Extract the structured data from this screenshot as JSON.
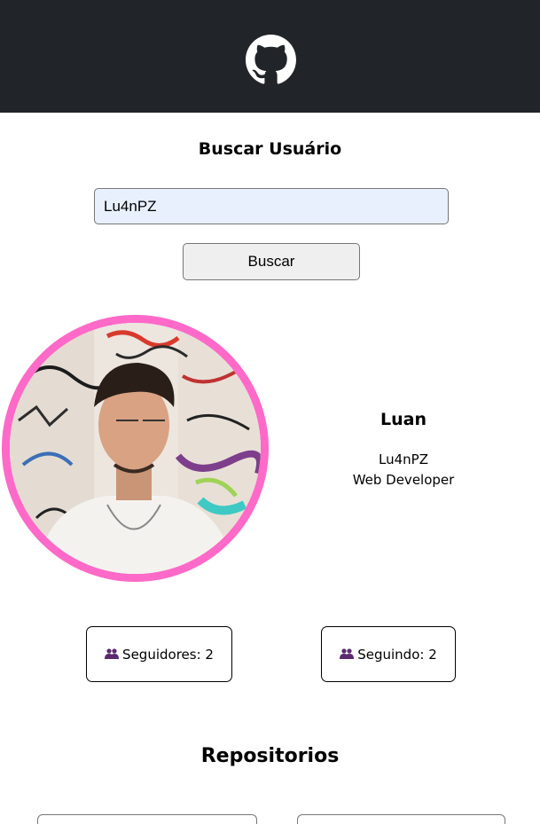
{
  "header": {
    "logo_icon": "github-icon"
  },
  "search": {
    "title": "Buscar Usuário",
    "value": "Lu4nPZ",
    "button_label": "Buscar"
  },
  "profile": {
    "name": "Luan",
    "login": "Lu4nPZ",
    "bio": "Web Developer",
    "avatar_border_color": "#ff69c8"
  },
  "stats": {
    "followers_label": "Seguidores: 2",
    "following_label": "Seguindo: 2",
    "icon": "people-icon",
    "icon_color": "#5b2a6e"
  },
  "repos": {
    "title": "Repositorios"
  }
}
